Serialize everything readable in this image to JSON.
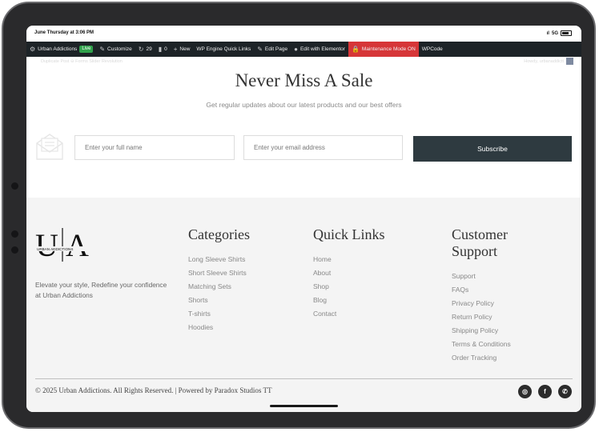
{
  "status_bar": {
    "time": "June Thursday at 3:06 PM",
    "network": "5G"
  },
  "admin_bar": {
    "site_name": "Urban Addictions",
    "live_badge": "Live",
    "customize": "Customize",
    "updates_count": "29",
    "comments_count": "0",
    "new": "New",
    "wp_engine": "WP Engine Quick Links",
    "edit_page": "Edit Page",
    "edit_elementor": "Edit with Elementor",
    "maintenance": "Maintenance Mode ON",
    "wpcode": "WPCode",
    "maintenance_color": "#d63638"
  },
  "ghost_bar": {
    "left": "Duplicate Post   ⊖ Forms   Slider Revolution",
    "right": "Howdy, urbanaddictt"
  },
  "newsletter": {
    "title": "Never Miss A Sale",
    "subtitle": "Get regular updates about our latest products and our best offers",
    "name_placeholder": "Enter your full name",
    "email_placeholder": "Enter your email address",
    "subscribe_label": "Subscribe"
  },
  "footer": {
    "logo_letters": "UA",
    "logo_small_text": "URBAN ADDICTIONS",
    "tagline": "Elevate your style, Redefine your confidence at Urban Addictions",
    "categories": {
      "heading": "Categories",
      "items": [
        "Long Sleeve Shirts",
        "Short Sleeve Shirts",
        "Matching Sets",
        "Shorts",
        "T-shirts",
        "Hoodies"
      ]
    },
    "quick_links": {
      "heading": "Quick Links",
      "items": [
        "Home",
        "About",
        "Shop",
        "Blog",
        "Contact"
      ]
    },
    "customer_support": {
      "heading_line1": "Customer",
      "heading_line2": "Support",
      "items": [
        "Support",
        "FAQs",
        "Privacy Policy",
        "Return Policy",
        "Shipping Policy",
        "Terms & Conditions",
        "Order Tracking"
      ]
    },
    "copyright": "© 2025 Urban Addictions. All Rights Reserved. | Powered by Paradox Studios TT",
    "social_icons": [
      "instagram-icon",
      "facebook-icon",
      "whatsapp-icon"
    ]
  }
}
